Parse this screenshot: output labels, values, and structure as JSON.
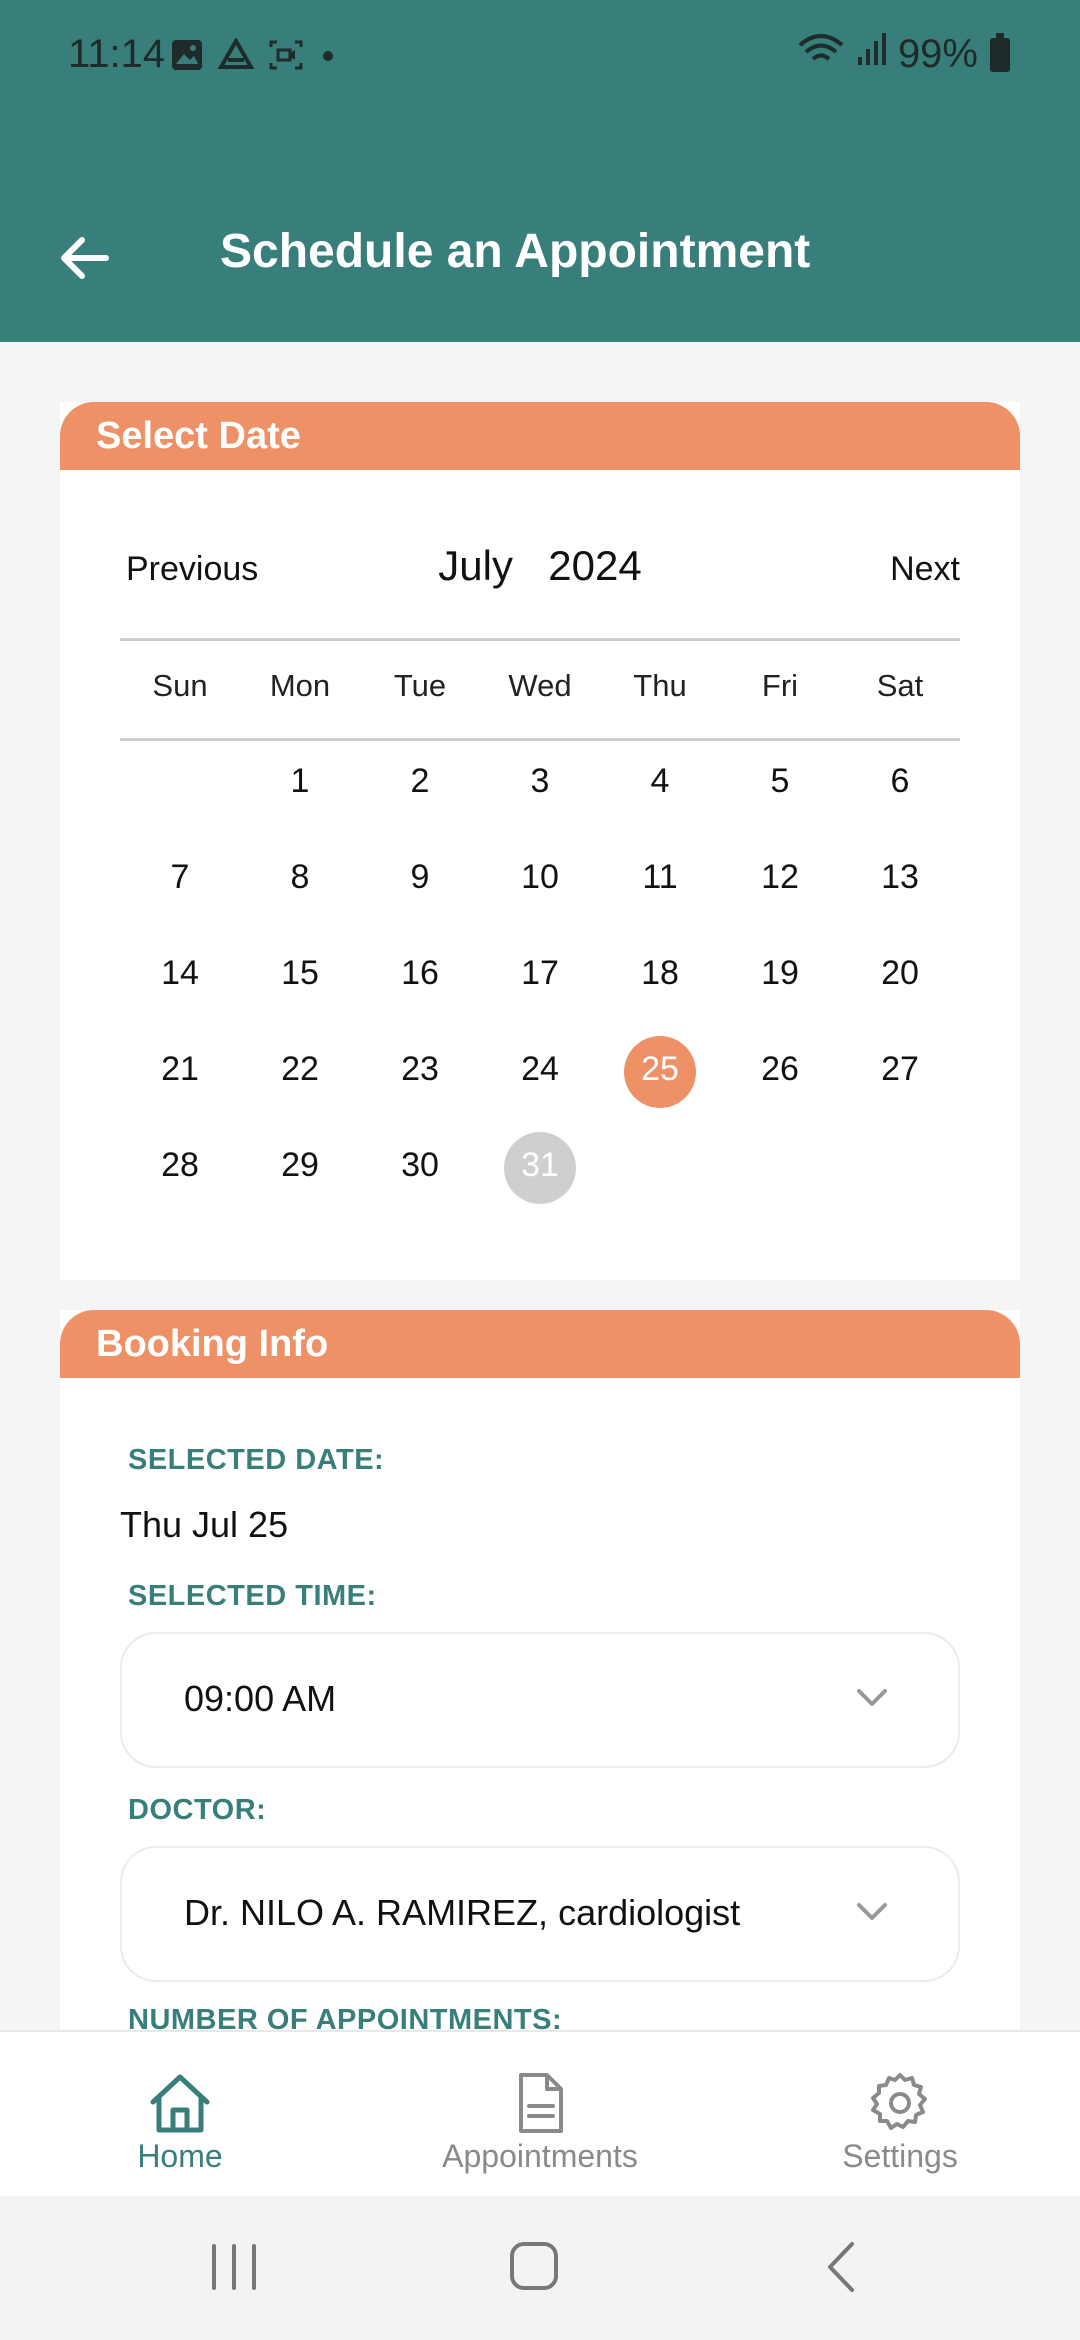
{
  "status": {
    "time": "11:14",
    "battery": "99%"
  },
  "header": {
    "title": "Schedule an Appointment"
  },
  "select_date": {
    "heading": "Select Date",
    "prev": "Previous",
    "next": "Next",
    "month": "July",
    "year": "2024",
    "weekdays": [
      "Sun",
      "Mon",
      "Tue",
      "Wed",
      "Thu",
      "Fri",
      "Sat"
    ],
    "weeks": [
      [
        "",
        "1",
        "2",
        "3",
        "4",
        "5",
        "6"
      ],
      [
        "7",
        "8",
        "9",
        "10",
        "11",
        "12",
        "13"
      ],
      [
        "14",
        "15",
        "16",
        "17",
        "18",
        "19",
        "20"
      ],
      [
        "21",
        "22",
        "23",
        "24",
        "25",
        "26",
        "27"
      ],
      [
        "28",
        "29",
        "30",
        "31",
        "",
        "",
        ""
      ]
    ],
    "selected_day": "25",
    "today_day": "31"
  },
  "booking": {
    "heading": "Booking Info",
    "date_label": "SELECTED DATE:",
    "date_value": "Thu Jul 25",
    "time_label": "SELECTED TIME:",
    "time_value": "09:00 AM",
    "doctor_label": "DOCTOR:",
    "doctor_value": "Dr. NILO A. RAMIREZ, cardiologist",
    "appointments_label": "NUMBER OF APPOINTMENTS:"
  },
  "nav": {
    "home": "Home",
    "appointments": "Appointments",
    "settings": "Settings"
  },
  "colors": {
    "teal": "#387f7b",
    "orange": "#ee9167",
    "grey_circle": "#cfcfcf"
  }
}
